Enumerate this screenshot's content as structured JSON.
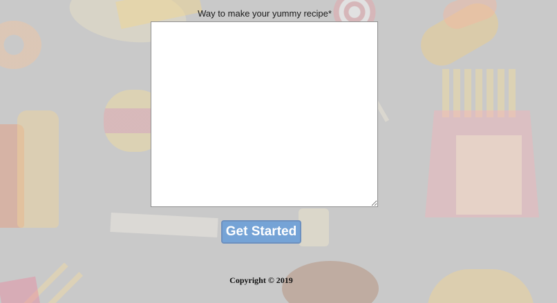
{
  "form": {
    "recipe_label": "Way to make your yummy recipe*",
    "recipe_value": "",
    "submit_label": "Get Started"
  },
  "footer": {
    "copyright": "Copyright © 2019"
  },
  "colors": {
    "background": "#c9c9c9",
    "button": "#75a3d6",
    "button_border": "#6d90bf"
  }
}
